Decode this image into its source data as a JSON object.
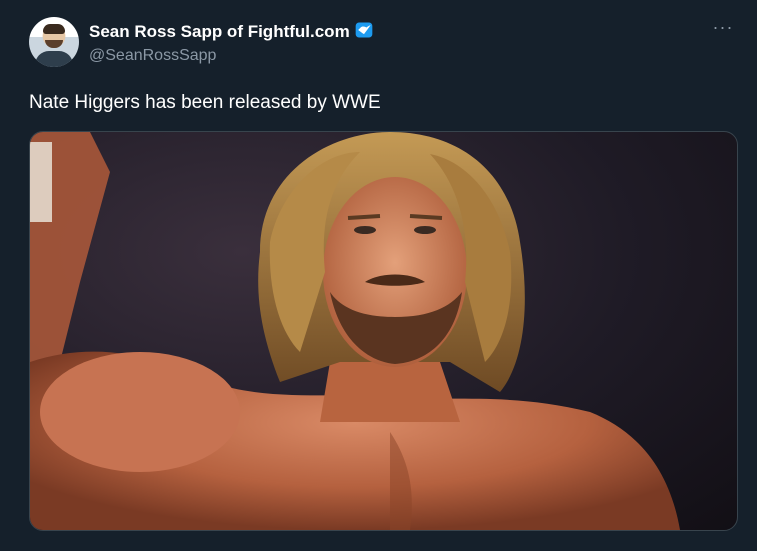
{
  "author": {
    "display_name": "Sean Ross Sapp of Fightful.com",
    "handle": "@SeanRossSapp",
    "verified": true,
    "avatar_icon": "avatar-photo"
  },
  "more_icon": "more-horizontal-icon",
  "tweet": {
    "text": "Nate Higgers has been released by WWE"
  },
  "colors": {
    "background": "#15202b",
    "secondary_text": "#8b98a5",
    "verified_blue": "#1d9bf0"
  }
}
